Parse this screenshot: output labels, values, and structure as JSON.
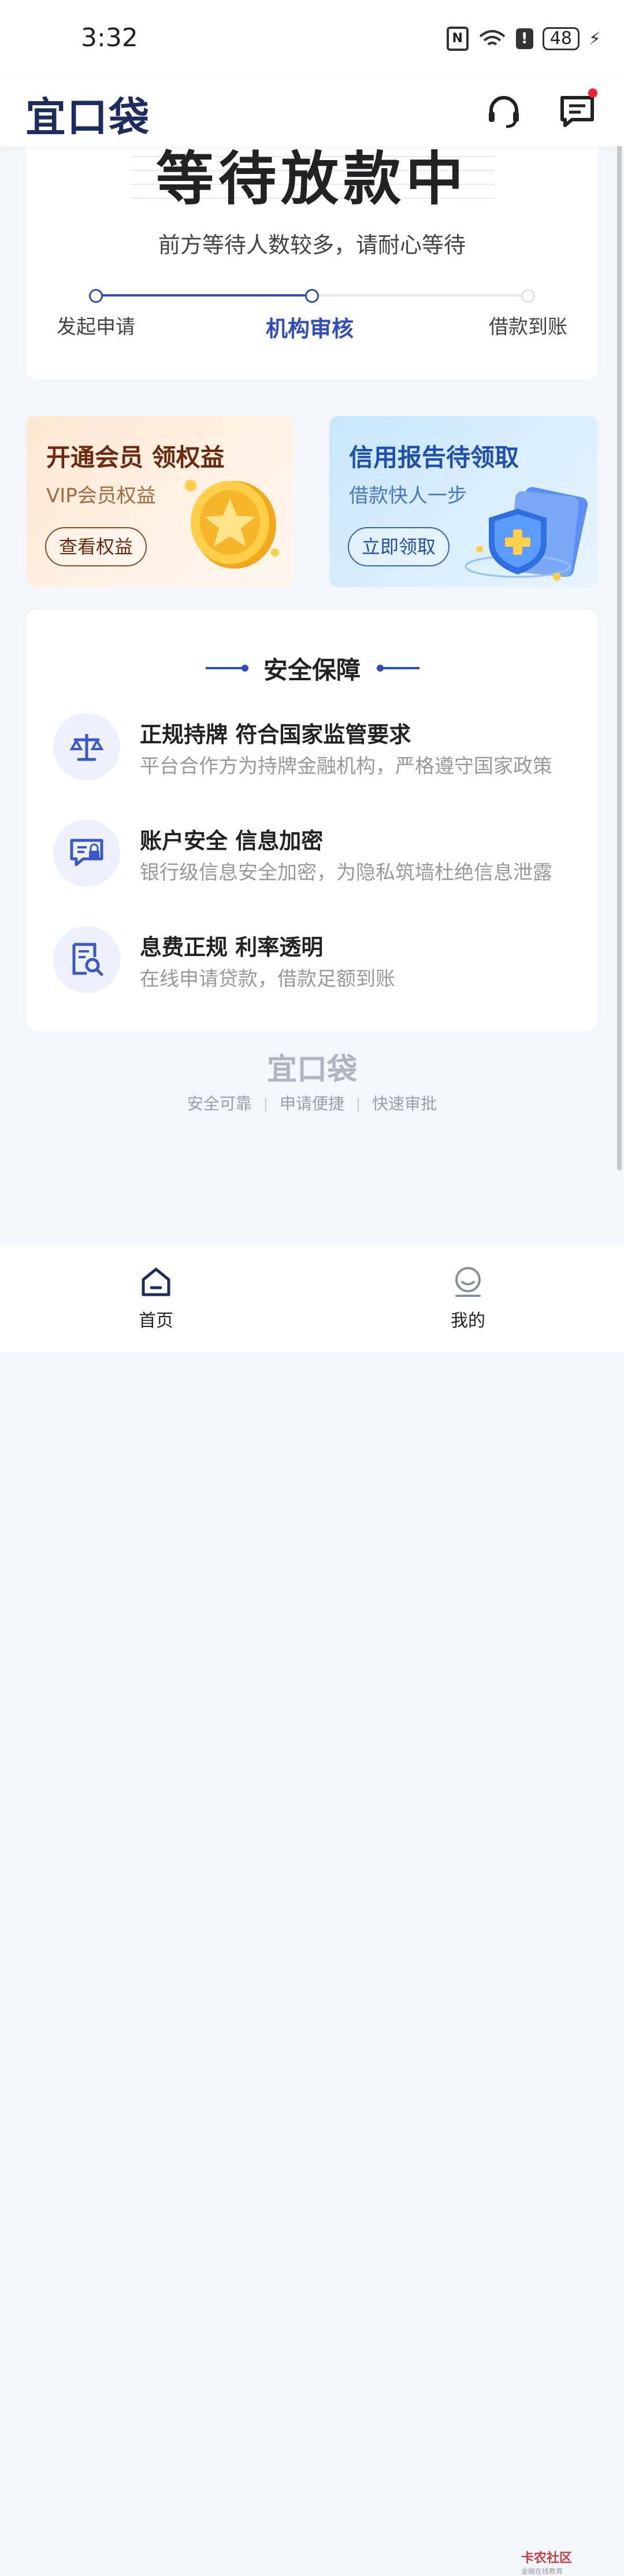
{
  "status_bar": {
    "time": "3:32",
    "battery": "48",
    "nfc": "N",
    "alert": "!"
  },
  "header": {
    "logo": "宜口袋"
  },
  "status_card": {
    "title": "等待放款中",
    "subtitle": "前方等待人数较多，请耐心等待",
    "steps": [
      {
        "label": "发起申请",
        "state": "done"
      },
      {
        "label": "机构审核",
        "state": "active"
      },
      {
        "label": "借款到账",
        "state": "pending"
      }
    ]
  },
  "promos": {
    "vip": {
      "title": "开通会员 领权益",
      "subtitle": "VIP会员权益",
      "button": "查看权益"
    },
    "credit": {
      "title": "信用报告待领取",
      "subtitle": "借款快人一步",
      "button": "立即领取"
    }
  },
  "security": {
    "title": "安全保障",
    "items": [
      {
        "title": "正规持牌 符合国家监管要求",
        "desc": "平台合作方为持牌金融机构，严格遵守国家政策",
        "icon": "scale-icon"
      },
      {
        "title": "账户安全 信息加密",
        "desc": "银行级信息安全加密，为隐私筑墙杜绝信息泄露",
        "icon": "lock-card-icon"
      },
      {
        "title": "息费正规  利率透明",
        "desc": "在线申请贷款，借款足额到账",
        "icon": "doc-search-icon"
      }
    ]
  },
  "footer": {
    "logo": "宜口袋",
    "tags": [
      "安全可靠",
      "申请便捷",
      "快速审批"
    ]
  },
  "bottom_nav": {
    "home": "首页",
    "mine": "我的"
  },
  "watermark": {
    "title": "卡农社区",
    "sub": "金融在线教育"
  },
  "colors": {
    "accent": "#2f4dbc",
    "brand": "#1d2b5e",
    "badge": "#f5222d"
  }
}
